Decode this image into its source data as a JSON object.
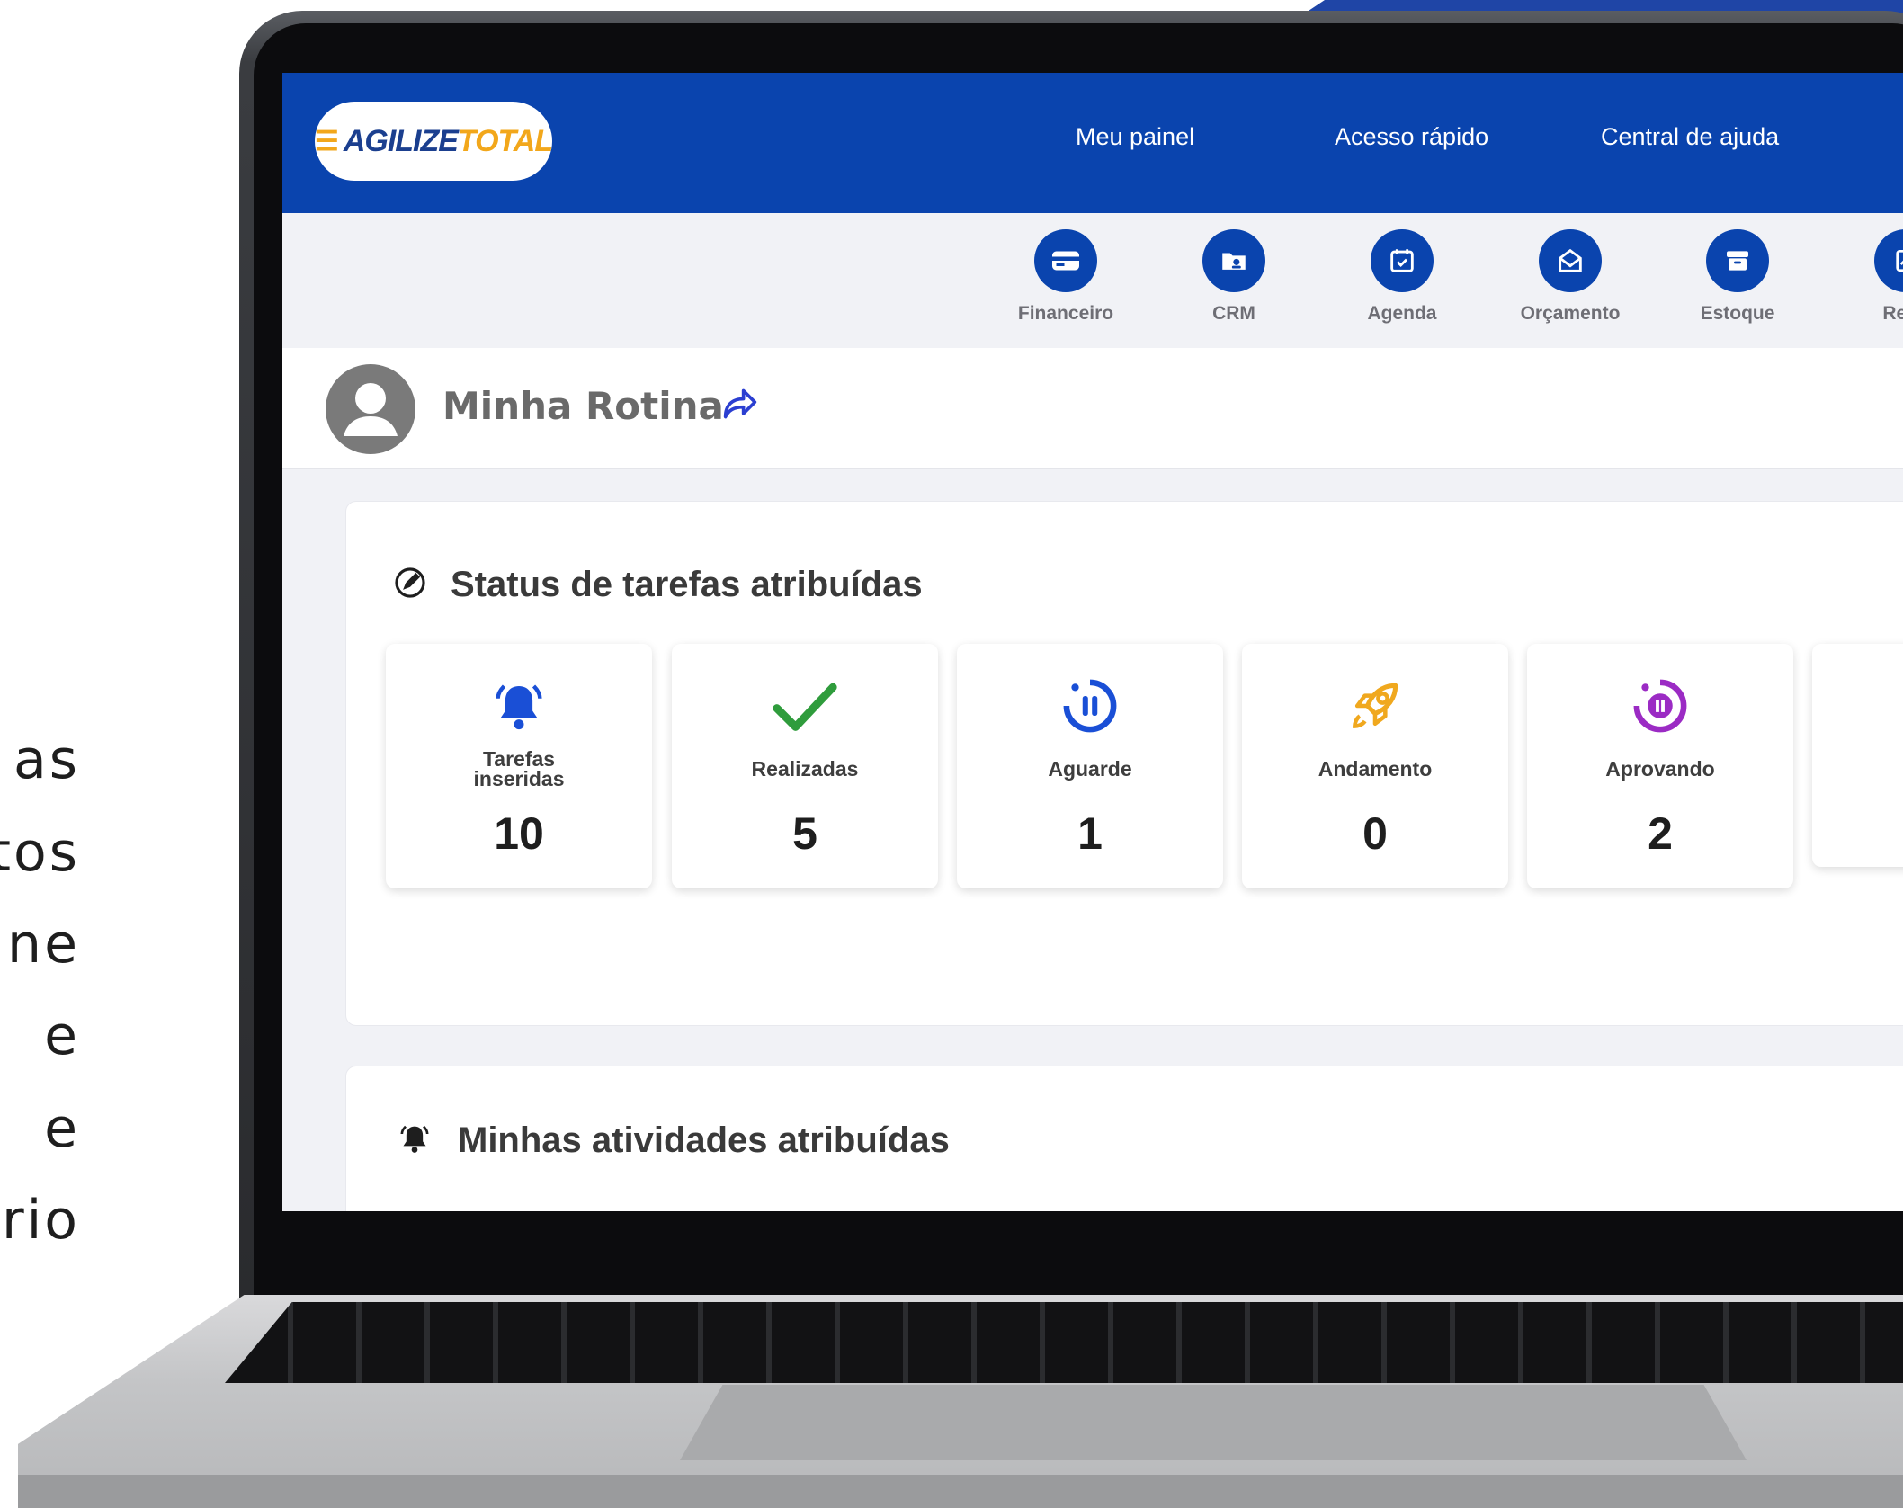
{
  "side_text": [
    "as",
    "tos",
    "ne",
    "e",
    "e",
    "rio"
  ],
  "header": {
    "logo_part1": "AGILIZE",
    "logo_part2": "TOTAL",
    "nav": [
      "Meu painel",
      "Acesso rápido",
      "Central de ajuda"
    ]
  },
  "modules": [
    {
      "label": "Financeiro",
      "icon": "credit-card-icon"
    },
    {
      "label": "CRM",
      "icon": "contacts-folder-icon"
    },
    {
      "label": "Agenda",
      "icon": "calendar-check-icon"
    },
    {
      "label": "Orçamento",
      "icon": "envelope-open-icon"
    },
    {
      "label": "Estoque",
      "icon": "archive-box-icon"
    },
    {
      "label": "Relat",
      "icon": "report-chart-icon"
    }
  ],
  "profile": {
    "title": "Minha Rotina",
    "share_icon": "share-arrow-icon"
  },
  "status_section": {
    "title": "Status de tarefas atribuídas",
    "icon": "pencil-circle-icon",
    "cards": [
      {
        "label": "Tarefas inseridas",
        "count": "10",
        "icon": "bell-ringing-icon",
        "color": "#1a4fd6"
      },
      {
        "label": "Realizadas",
        "count": "5",
        "icon": "check-icon",
        "color": "#2f9c3c"
      },
      {
        "label": "Aguarde",
        "count": "1",
        "icon": "pause-circle-icon",
        "color": "#1a4fd6"
      },
      {
        "label": "Andamento",
        "count": "0",
        "icon": "rocket-icon",
        "color": "#f0a81e"
      },
      {
        "label": "Aprovando",
        "count": "2",
        "icon": "pause-target-icon",
        "color": "#9b2bc4"
      },
      {
        "label": "",
        "count": "",
        "icon": "",
        "color": ""
      }
    ]
  },
  "activities_section": {
    "title": "Minhas atividades atribuídas",
    "icon": "bell-icon"
  },
  "colors": {
    "brand_blue": "#0a44ae",
    "accent_orange": "#f2a71b"
  }
}
